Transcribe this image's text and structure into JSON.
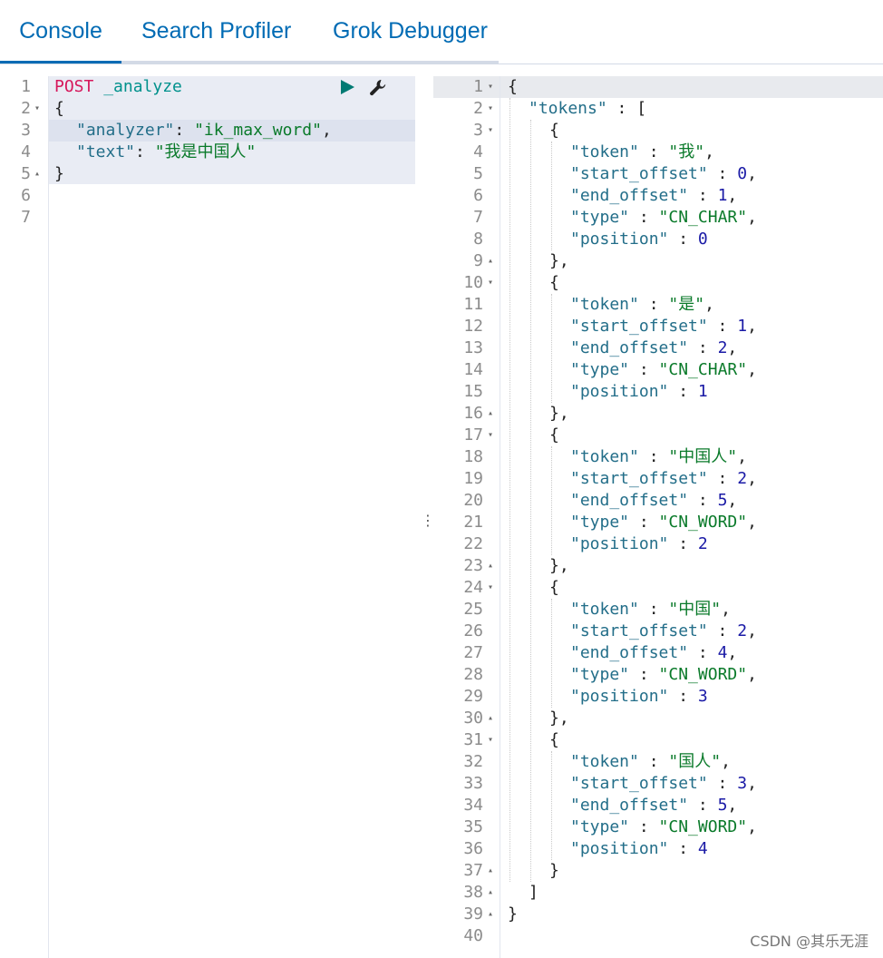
{
  "tabs": [
    {
      "label": "Console",
      "active": true
    },
    {
      "label": "Search Profiler",
      "active": false
    },
    {
      "label": "Grok Debugger",
      "active": false
    }
  ],
  "request": {
    "line_numbers": [
      "1",
      "2",
      "3",
      "4",
      "5",
      "6",
      "7"
    ],
    "method": "POST",
    "endpoint": "_analyze",
    "open_brace": "{",
    "analyzer_key": "\"analyzer\"",
    "analyzer_value": "\"ik_max_word\"",
    "text_key": "\"text\"",
    "text_value": "\"我是中国人\"",
    "close_brace": "}",
    "run_icon": "play-icon",
    "settings_icon": "wrench-icon"
  },
  "response": {
    "line_numbers": [
      "1",
      "2",
      "3",
      "4",
      "5",
      "6",
      "7",
      "8",
      "9",
      "10",
      "11",
      "12",
      "13",
      "14",
      "15",
      "16",
      "17",
      "18",
      "19",
      "20",
      "21",
      "22",
      "23",
      "24",
      "25",
      "26",
      "27",
      "28",
      "29",
      "30",
      "31",
      "32",
      "33",
      "34",
      "35",
      "36",
      "37",
      "38",
      "39",
      "40"
    ],
    "tokens_key": "\"tokens\"",
    "tokens": [
      {
        "token": "\"我\"",
        "start_offset": "0",
        "end_offset": "1",
        "type": "\"CN_CHAR\"",
        "position": "0"
      },
      {
        "token": "\"是\"",
        "start_offset": "1",
        "end_offset": "2",
        "type": "\"CN_CHAR\"",
        "position": "1"
      },
      {
        "token": "\"中国人\"",
        "start_offset": "2",
        "end_offset": "5",
        "type": "\"CN_WORD\"",
        "position": "2"
      },
      {
        "token": "\"中国\"",
        "start_offset": "2",
        "end_offset": "4",
        "type": "\"CN_WORD\"",
        "position": "3"
      },
      {
        "token": "\"国人\"",
        "start_offset": "3",
        "end_offset": "5",
        "type": "\"CN_WORD\"",
        "position": "4"
      }
    ],
    "field_labels": {
      "token": "\"token\"",
      "start_offset": "\"start_offset\"",
      "end_offset": "\"end_offset\"",
      "type": "\"type\"",
      "position": "\"position\""
    }
  },
  "splitter_icon": "drag-handle-icon",
  "watermark": "CSDN @其乐无涯"
}
